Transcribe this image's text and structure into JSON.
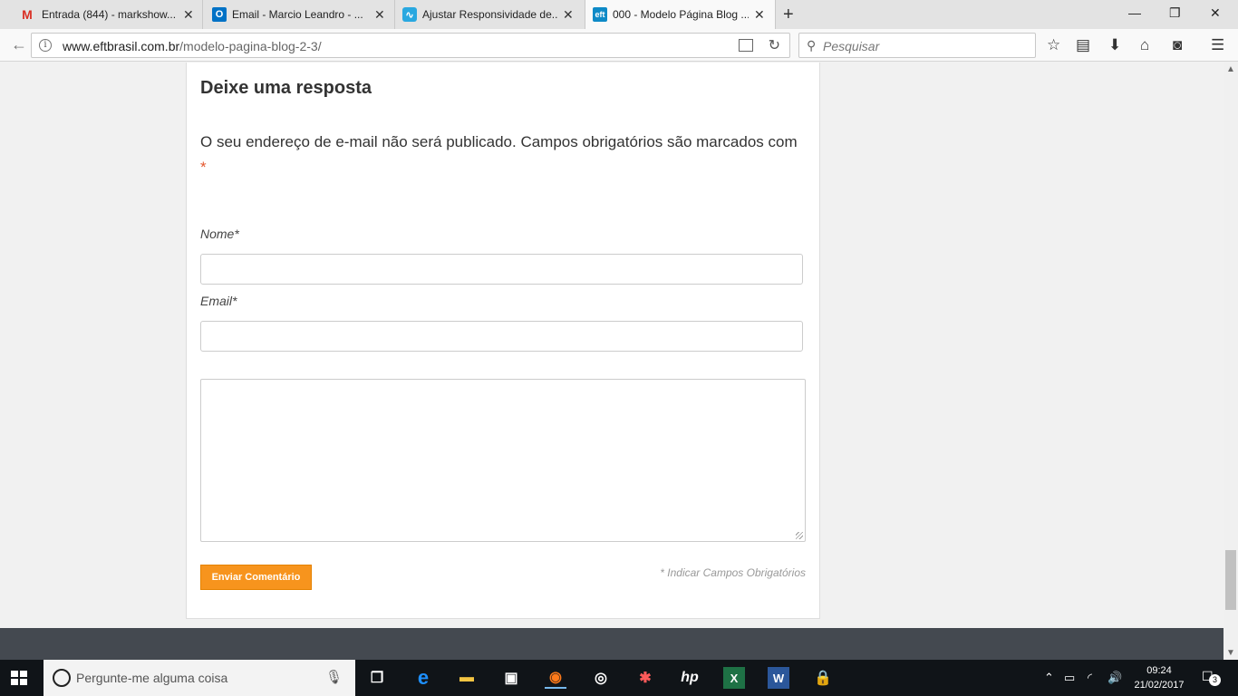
{
  "tabs": [
    {
      "title": "Entrada (844) - markshow...",
      "favicon": "gmail-icon",
      "fav_glyph": "M",
      "fav_color": "#d93025"
    },
    {
      "title": "Email - Marcio Leandro - ...",
      "favicon": "outlook-icon",
      "fav_glyph": "O",
      "fav_color": "#0072c6"
    },
    {
      "title": "Ajustar Responsividade de...",
      "favicon": "site-icon",
      "fav_glyph": "∿",
      "fav_color": "#29a8e0"
    },
    {
      "title": "000 - Modelo Página Blog ...",
      "favicon": "eft-icon",
      "fav_glyph": "eft",
      "fav_color": "#0e8ac7"
    }
  ],
  "nav": {
    "url_domain": "www.eftbrasil.com.br",
    "url_path": "/modelo-pagina-blog-2-3/",
    "search_placeholder": "Pesquisar"
  },
  "form": {
    "heading": "Deixe uma resposta",
    "note": "O seu endereço de e-mail não será publicado. Campos obrigatórios são marcados com",
    "required_mark": "*",
    "name_label": "Nome*",
    "email_label": "Email*",
    "submit_label": "Enviar Comentário",
    "required_note": "* Indicar Campos Obrigatórios",
    "accent_color": "#f7941d"
  },
  "taskbar": {
    "search_placeholder": "Pergunte-me alguma coisa",
    "time": "09:24",
    "date": "21/02/2017",
    "notification_count": "3"
  }
}
